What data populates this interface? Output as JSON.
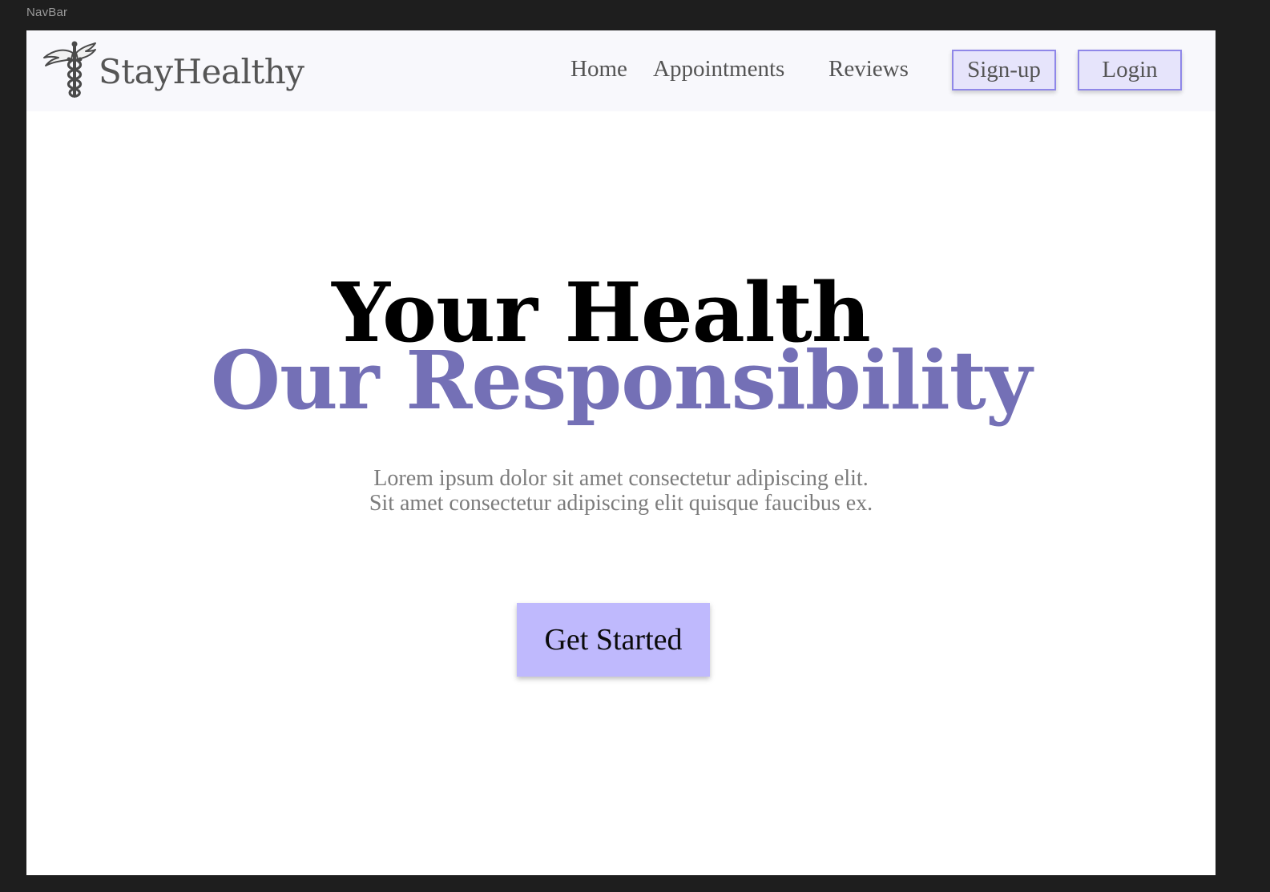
{
  "frame": {
    "label": "NavBar"
  },
  "navbar": {
    "brand": {
      "name": "StayHealthy",
      "icon": "caduceus-icon"
    },
    "links": {
      "home": "Home",
      "appointments": "Appointments",
      "reviews": "Reviews"
    },
    "buttons": {
      "signup": "Sign-up",
      "login": "Login"
    }
  },
  "hero": {
    "title_line1": "Your Health",
    "title_line2": "Our Responsibility",
    "subtitle_line1": "Lorem ipsum dolor sit amet consectetur adipiscing elit.",
    "subtitle_line2": "Sit amet consectetur adipiscing elit quisque faucibus ex.",
    "cta_label": "Get Started"
  },
  "colors": {
    "canvas_background": "#1e1e1e",
    "page_background": "#ffffff",
    "navbar_background": "#f8f8fc",
    "accent_text": "#7470b6",
    "button_fill": "#e6e4fb",
    "button_border": "#8f87e8",
    "cta_fill": "#bfb9fd"
  }
}
